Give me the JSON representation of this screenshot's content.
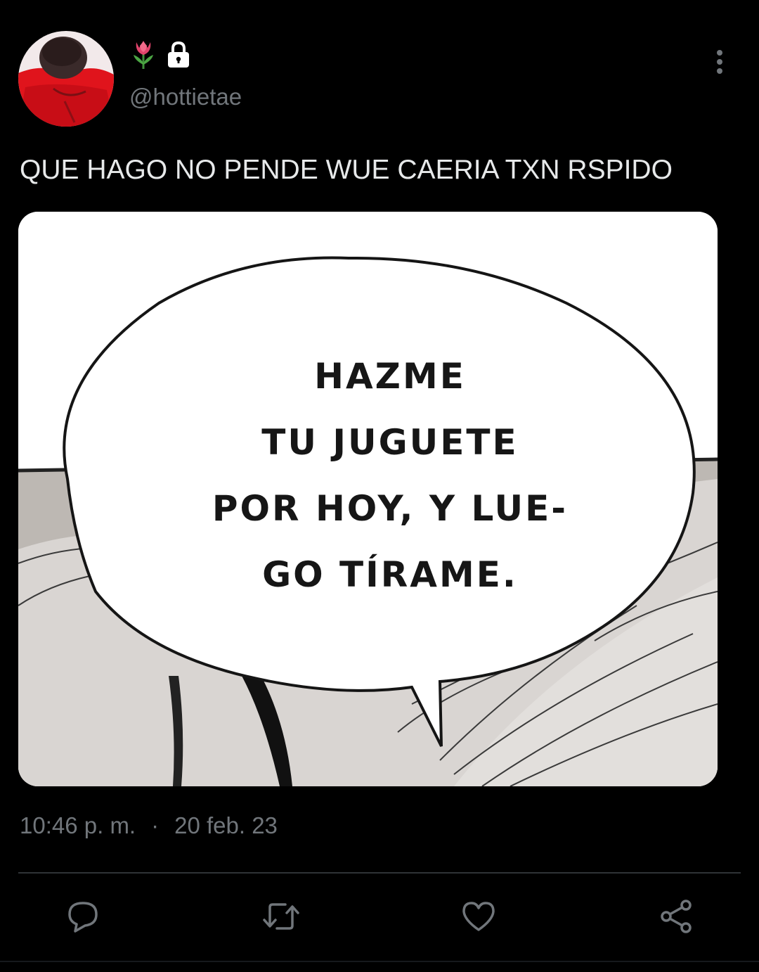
{
  "user": {
    "avatar_icon": "profile-photo",
    "name_icons": [
      "tulip-emoji-icon",
      "lock-icon"
    ],
    "handle": "@hottietae"
  },
  "tweet": {
    "text": "QUE HAGO NO PENDE WUE CAERIA TXN RSPIDO",
    "media": {
      "bubble_lines": [
        "HAZME",
        "TU JUGUETE",
        "POR HOY, Y LUE-",
        "GO TÍRAME."
      ]
    },
    "time": "10:46 p. m.",
    "separator": "·",
    "date": "20 feb. 23"
  },
  "actions": [
    {
      "name": "reply",
      "icon": "speech-bubble-icon"
    },
    {
      "name": "retweet",
      "icon": "retweet-icon"
    },
    {
      "name": "like",
      "icon": "heart-icon"
    },
    {
      "name": "share",
      "icon": "share-icon"
    }
  ],
  "colors": {
    "background": "#000000",
    "text": "#e7e9ea",
    "secondary_text": "#71767b",
    "divider": "#2f3336",
    "avatar_red": "#e0141c",
    "tulip_red": "#e0436b"
  }
}
